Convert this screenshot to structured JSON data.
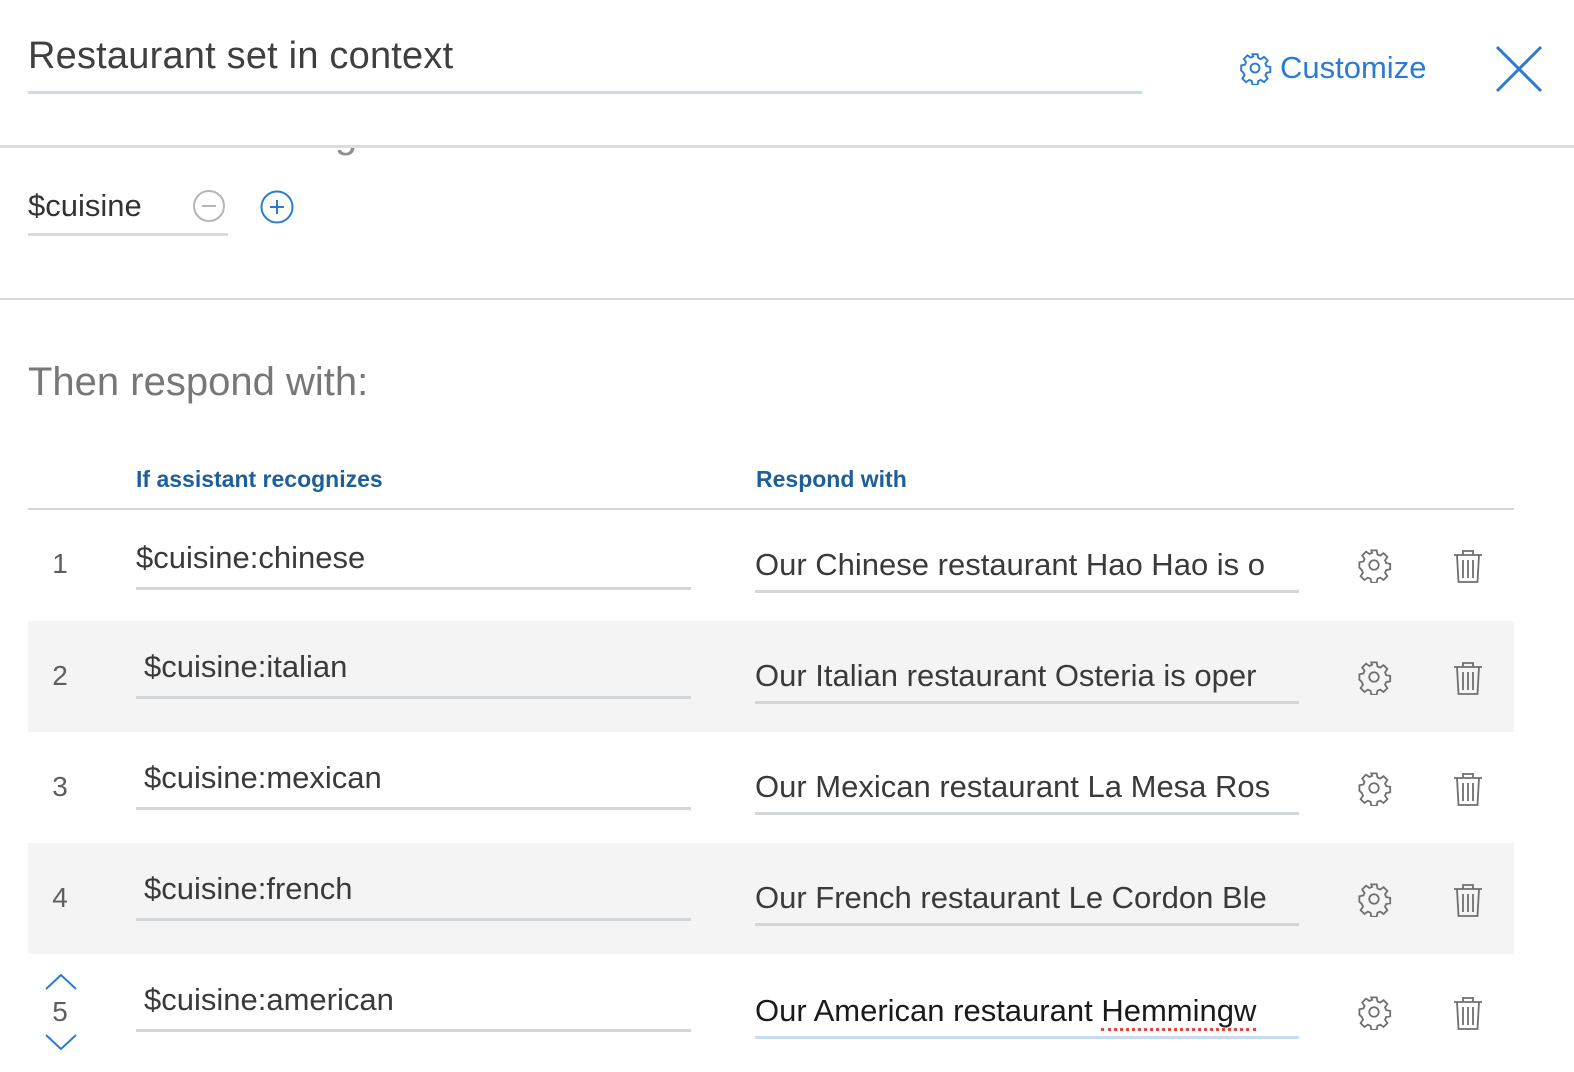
{
  "header": {
    "title": "Restaurant set in context",
    "customize_label": "Customize"
  },
  "context": {
    "hidden_heading": "Then set context g",
    "variable": "$cuisine"
  },
  "responses": {
    "section_title": "Then respond with:",
    "columns": {
      "condition": "If assistant recognizes",
      "response": "Respond with"
    },
    "rows": [
      {
        "number": "1",
        "condition": "$cuisine:chinese",
        "response": "Our Chinese restaurant Hao Hao is o"
      },
      {
        "number": "2",
        "condition": "$cuisine:italian",
        "response": "Our Italian restaurant Osteria is oper"
      },
      {
        "number": "3",
        "condition": "$cuisine:mexican",
        "response": "Our Mexican restaurant La Mesa Ros"
      },
      {
        "number": "4",
        "condition": "$cuisine:french",
        "response": "Our French restaurant Le Cordon Ble"
      },
      {
        "number": "5",
        "condition": "$cuisine:american",
        "response_prefix": "Our American restaurant ",
        "response_misspelled": "Hemmingw"
      }
    ]
  },
  "colors": {
    "accent": "#2a7bd1",
    "column_header": "#1f5f99",
    "row_shade": "#f4f4f4",
    "active_underline": "#c7dcf3",
    "spellcheck": "#e2483d"
  },
  "icons": {
    "customize": "gear-icon",
    "close": "close-icon",
    "remove_variable": "minus-circle-icon",
    "add_variable": "plus-circle-icon",
    "row_settings": "gear-icon",
    "row_delete": "trash-icon",
    "move_up": "chevron-up-icon",
    "move_down": "chevron-down-icon"
  }
}
